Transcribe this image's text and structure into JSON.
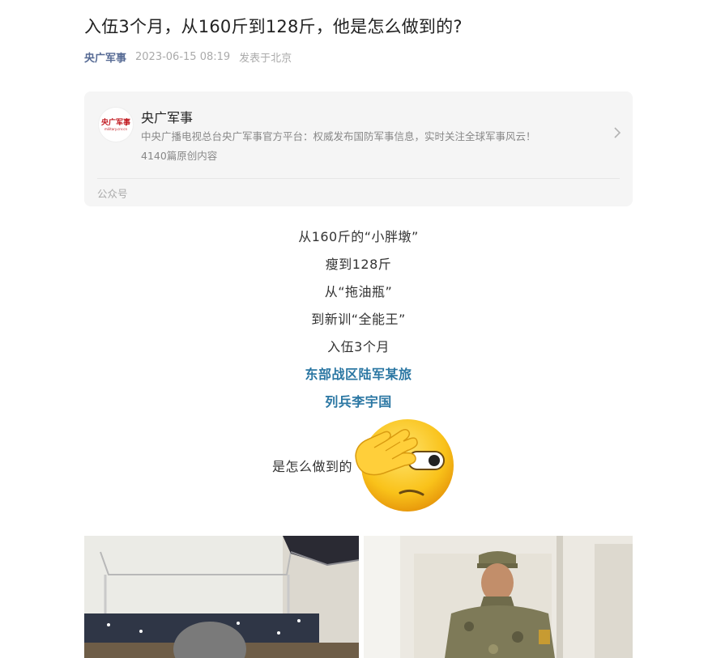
{
  "article": {
    "title": "入伍3个月，从160斤到128斤，他是怎么做到的?",
    "author": "央广军事",
    "date": "2023-06-15 08:19",
    "location": "发表于北京"
  },
  "account_card": {
    "logo_text": "央广军事",
    "logo_sub": "military.cnr.cn",
    "name": "央广军事",
    "description": "中央广播电视总台央广军事官方平台：权威发布国防军事信息，实时关注全球军事风云！",
    "original_count": "4140篇原创内容",
    "type_label": "公众号",
    "chevron_icon": "chevron-right-icon"
  },
  "body": {
    "lines": [
      "从160斤的“小胖墩”",
      "瘦到128斤",
      "从“拖油瓶”",
      "到新训“全能王”",
      "入伍3个月"
    ],
    "highlight_lines": [
      "东部战区陆军某旅",
      "列兵李宇国"
    ],
    "question_text": "是怎么做到的",
    "emoji_icon": "facepalm-peek-emoji-icon"
  },
  "colors": {
    "accent_link": "#576b95",
    "highlight": "#2b77a3",
    "brand_red": "#c0141b"
  }
}
